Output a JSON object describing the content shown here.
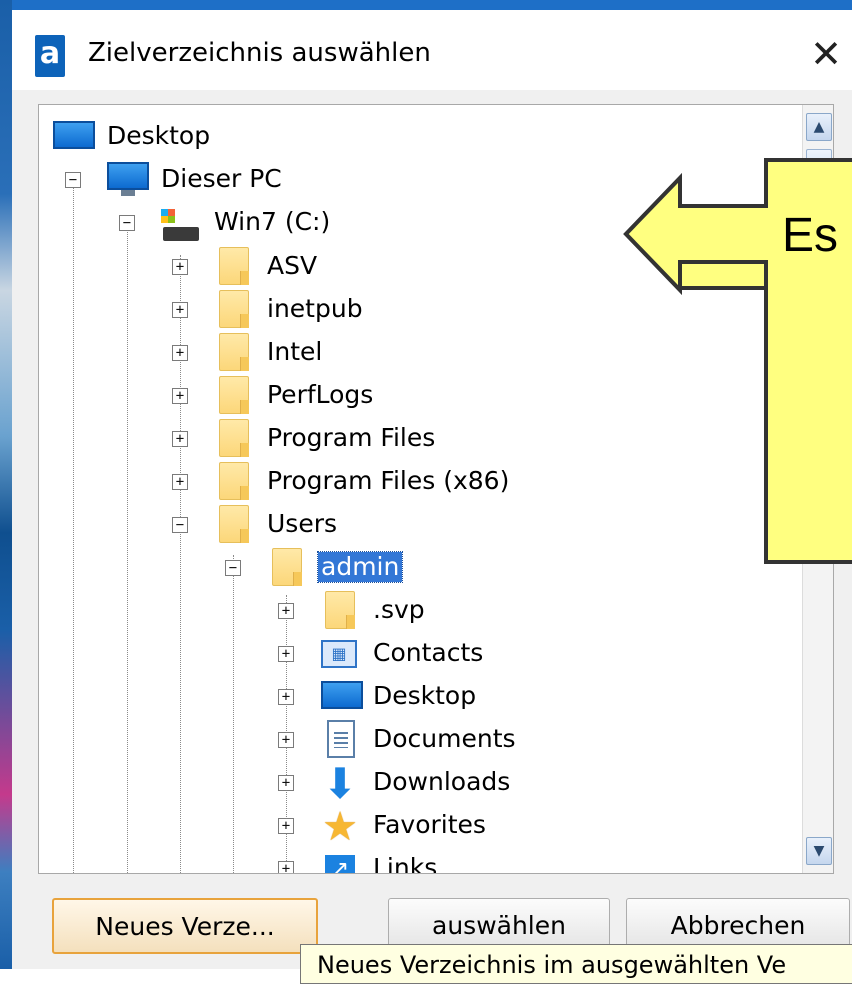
{
  "dialog": {
    "title": "Zielverzeichnis auswählen",
    "close_symbol": "✕",
    "app_icon_letter": "a"
  },
  "tree": {
    "root": {
      "label": "Desktop",
      "icon": "desktop-icon"
    },
    "pc": {
      "label": "Dieser PC",
      "icon": "computer-icon",
      "toggle": "−"
    },
    "drive": {
      "label": "Win7 (C:)",
      "icon": "drive-icon",
      "toggle": "−"
    },
    "folders": [
      {
        "label": "ASV",
        "toggle": "+"
      },
      {
        "label": "inetpub",
        "toggle": "+"
      },
      {
        "label": "Intel",
        "toggle": "+"
      },
      {
        "label": "PerfLogs",
        "toggle": "+"
      },
      {
        "label": "Program Files",
        "toggle": "+"
      },
      {
        "label": "Program Files (x86)",
        "toggle": "+"
      },
      {
        "label": "Users",
        "toggle": "−"
      }
    ],
    "user": {
      "label": "admin",
      "toggle": "−",
      "selected": true
    },
    "user_items": [
      {
        "label": ".svp",
        "icon": "folder-icon",
        "toggle": "+"
      },
      {
        "label": "Contacts",
        "icon": "contacts-icon",
        "toggle": "+"
      },
      {
        "label": "Desktop",
        "icon": "desktop-icon",
        "toggle": "+"
      },
      {
        "label": "Documents",
        "icon": "documents-icon",
        "toggle": "+"
      },
      {
        "label": "Downloads",
        "icon": "downloads-icon",
        "toggle": "+"
      },
      {
        "label": "Favorites",
        "icon": "favorites-icon",
        "toggle": "+"
      },
      {
        "label": "Links",
        "icon": "links-icon",
        "toggle": "+"
      }
    ]
  },
  "scrollbar": {
    "up": "▲",
    "down": "▼"
  },
  "callout": {
    "text": "Es",
    "fill": "#ffff80",
    "stroke": "#333333"
  },
  "buttons": {
    "new_folder": "Neues Verze...",
    "select": "auswählen",
    "cancel": "Abbrechen"
  },
  "tooltip": {
    "text": "Neues Verzeichnis im ausgewählten Ve"
  },
  "colors": {
    "title_accent": "#1e6fc7",
    "selection": "#3377d6"
  }
}
